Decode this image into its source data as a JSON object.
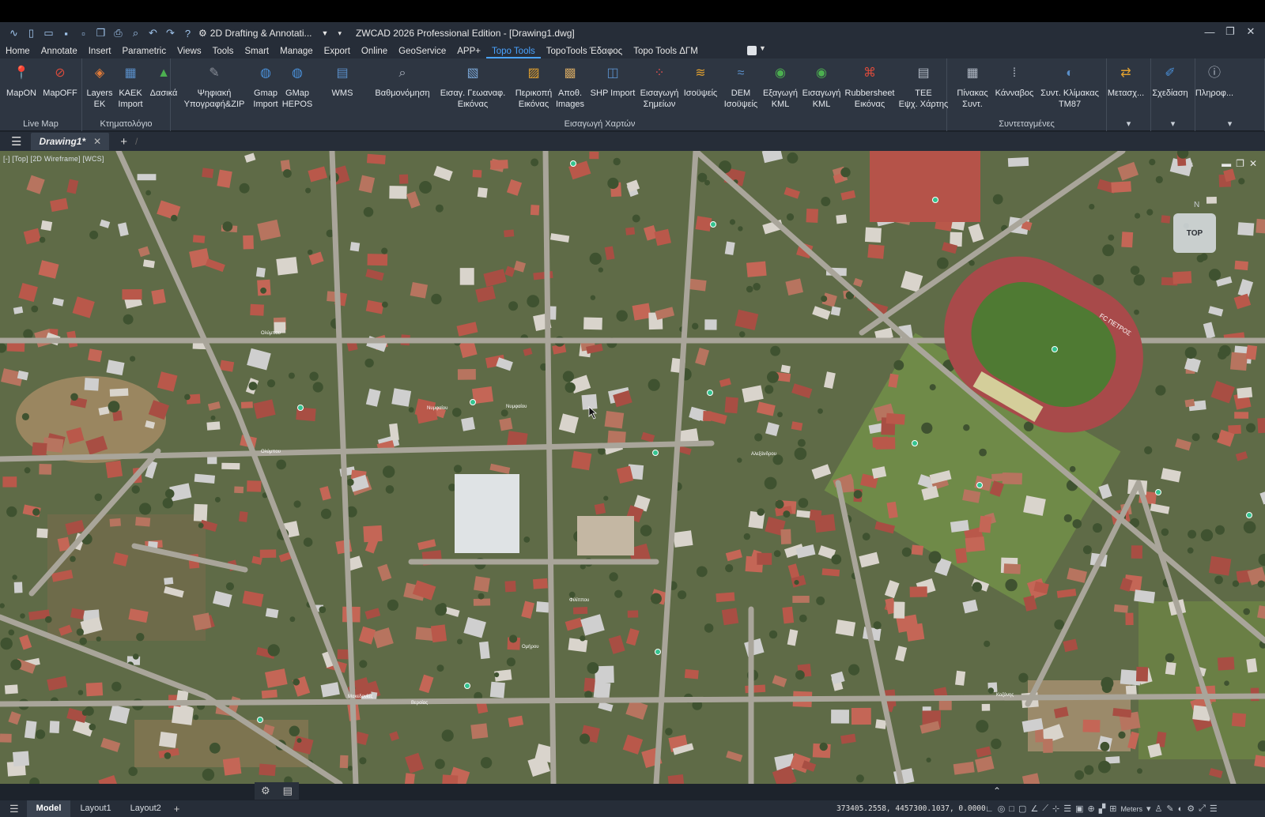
{
  "app": {
    "workspace": "2D Drafting & Annotati...",
    "title": "ZWCAD 2026 Professional Edition - [Drawing1.dwg]"
  },
  "quick_access": [
    "logo-icon",
    "new-icon",
    "open-icon",
    "save-icon",
    "saveas-icon",
    "copy-icon",
    "print-icon",
    "preview-icon",
    "undo-icon",
    "redo-icon",
    "help-icon"
  ],
  "menu": [
    "Home",
    "Annotate",
    "Insert",
    "Parametric",
    "Views",
    "Tools",
    "Smart",
    "Manage",
    "Export",
    "Online",
    "GeoService",
    "APP+",
    "Topo Tools",
    "TopoTools Έδαφος",
    "Topo Tools ΔΓΜ"
  ],
  "menu_active": "Topo Tools",
  "ribbon": {
    "groups": [
      {
        "label": "Live Map",
        "buttons": [
          {
            "l1": "MapON",
            "l2": "",
            "icon": "map-pin-icon",
            "color": "#d94b3c"
          },
          {
            "l1": "MapOFF",
            "l2": "",
            "icon": "map-off-icon",
            "color": "#d94b3c"
          }
        ]
      },
      {
        "label": "Κτηματολόγιο",
        "buttons": [
          {
            "l1": "Layers",
            "l2": "ΕΚ",
            "icon": "layers-icon",
            "color": "#e07b39"
          },
          {
            "l1": "ΚΑΕΚ",
            "l2": "Import",
            "icon": "parcel-import-icon",
            "color": "#5a8fc9"
          },
          {
            "l1": "Δασικά",
            "l2": "",
            "icon": "forest-icon",
            "color": "#4caf50"
          },
          {
            "l1": "Ψηφιακή",
            "l2": "Υπογραφή&ZIP",
            "icon": "signature-icon",
            "color": "#8a8f99"
          }
        ]
      },
      {
        "label": "Εισαγωγή Χαρτών",
        "buttons": [
          {
            "l1": "Gmap",
            "l2": "Import",
            "icon": "globe-icon",
            "color": "#4a90d9"
          },
          {
            "l1": "GMap",
            "l2": "HEPOS",
            "icon": "globe-icon",
            "color": "#4a90d9"
          },
          {
            "l1": "WMS",
            "l2": "",
            "icon": "wms-icon",
            "color": "#5a8fc9"
          },
          {
            "l1": "Βαθμονόμηση",
            "l2": "",
            "icon": "calibrate-icon",
            "color": "#b0b8c4"
          },
          {
            "l1": "Εισαγ. Γεωαναφ.",
            "l2": "Εικόνας",
            "icon": "georef-image-icon",
            "color": "#7aa6d6"
          },
          {
            "l1": "Περικοπή",
            "l2": "Εικόνας",
            "icon": "crop-image-icon",
            "color": "#e0a030"
          },
          {
            "l1": "Αποθ.",
            "l2": "Images",
            "icon": "save-images-icon",
            "color": "#c9a060"
          },
          {
            "l1": "SHP Import",
            "l2": "",
            "icon": "shp-import-icon",
            "color": "#5a8fc9"
          },
          {
            "l1": "Εισαγωγή",
            "l2": "Σημείων",
            "icon": "points-icon",
            "color": "#e05050"
          },
          {
            "l1": "Ισοϋψείς",
            "l2": "",
            "icon": "contours-icon",
            "color": "#e0a030"
          },
          {
            "l1": "DEM",
            "l2": "Ισοϋψείς",
            "icon": "dem-icon",
            "color": "#5a8fc9"
          },
          {
            "l1": "Εξαγωγή",
            "l2": "KML",
            "icon": "kml-export-icon",
            "color": "#4caf50"
          },
          {
            "l1": "Εισαγωγή",
            "l2": "KML",
            "icon": "kml-import-icon",
            "color": "#4caf50"
          },
          {
            "l1": "Rubbersheet",
            "l2": "Εικόνας",
            "icon": "rubbersheet-icon",
            "color": "#d94b3c"
          },
          {
            "l1": "ΤΕΕ",
            "l2": "Εψχ. Χάρτης",
            "icon": "map-book-icon",
            "color": "#b0b8c4"
          }
        ]
      },
      {
        "label": "Συντεταγμένες",
        "buttons": [
          {
            "l1": "Πίνακας",
            "l2": "Συντ.",
            "icon": "table-icon",
            "color": "#b0b8c4"
          },
          {
            "l1": "Κάνναβος",
            "l2": "",
            "icon": "grid-icon",
            "color": "#b0b8c4"
          },
          {
            "l1": "Συντ. Κλίμακας",
            "l2": "ΤΜ87",
            "icon": "scale-factor-icon",
            "color": "#5a8fc9"
          }
        ]
      },
      {
        "label": "",
        "buttons": [
          {
            "l1": "Μετασχ...",
            "l2": "",
            "icon": "transform-icon",
            "color": "#e0a030"
          }
        ]
      },
      {
        "label": "",
        "buttons": [
          {
            "l1": "Σχεδίαση",
            "l2": "",
            "icon": "draw-icon",
            "color": "#4a90d9"
          }
        ]
      },
      {
        "label": "",
        "buttons": [
          {
            "l1": "Πληροφ...",
            "l2": "",
            "icon": "info-icon",
            "color": "#b0b8c4"
          }
        ]
      }
    ]
  },
  "doc_tab": "Drawing1*",
  "viewport": {
    "label": "[-] [Top] [2D Wireframe] [WCS]",
    "viewcube": "TOP"
  },
  "map": {
    "streets": [
      "Ολύμπου",
      "Ολύμπου",
      "Νυμφαίου",
      "Νυμφαίου",
      "Ομήρου",
      "Φιλίππου",
      "Αλεξάνδρου",
      "Μακεδονίας",
      "Βεροίας",
      "Κοζάνης"
    ],
    "stadium": "FC ΠΕΤΡΟΣ"
  },
  "status": {
    "tabs": [
      "Model",
      "Layout1",
      "Layout2"
    ],
    "active_tab": "Model",
    "coords": "373405.2558, 4457300.1037, 0.0000",
    "units": "Meters"
  }
}
